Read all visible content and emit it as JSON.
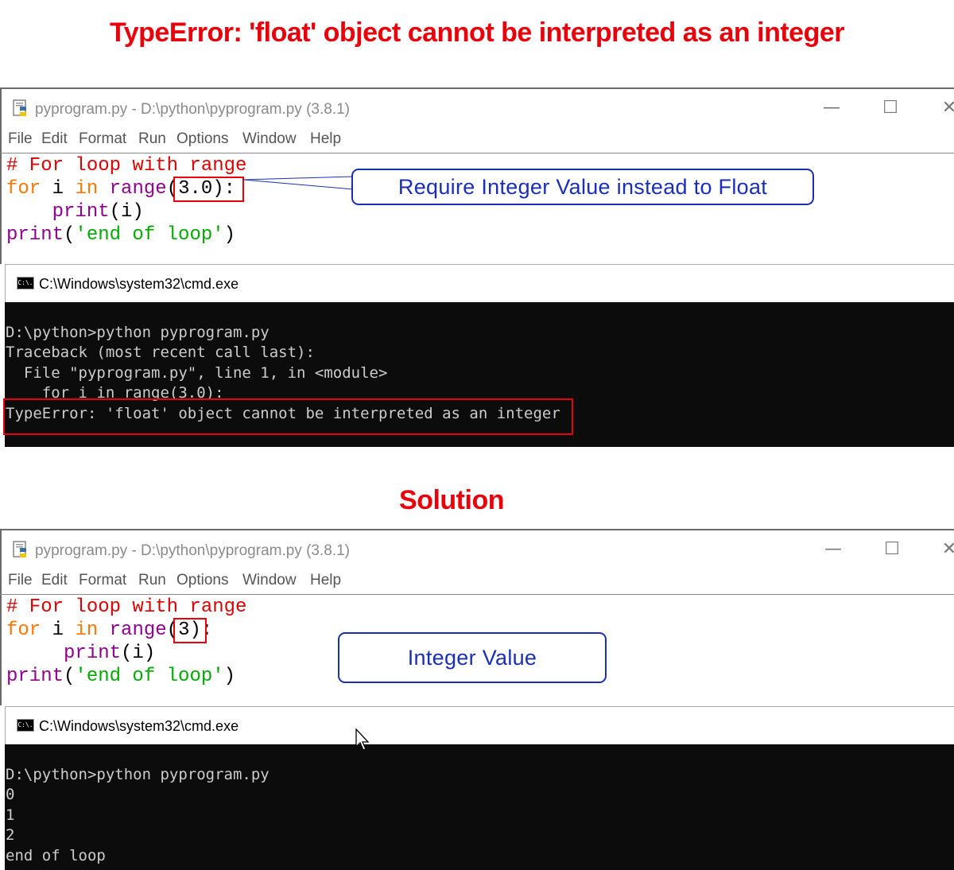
{
  "top_heading": "TypeError: 'float' object cannot be interpreted as an integer",
  "solution_heading": "Solution",
  "idle_window_1": {
    "title": "pyprogram.py - D:\\python\\pyprogram.py (3.8.1)",
    "menu": [
      "File",
      "Edit",
      "Format",
      "Run",
      "Options",
      "Window",
      "Help"
    ],
    "code": {
      "comment": "# For loop with range",
      "line2_kw_for": "for",
      "line2_var": " i ",
      "line2_kw_in": "in",
      "line2_builtin": " range",
      "line2_arg": "(3.0):",
      "line3_indent": "    ",
      "line3_builtin": "print",
      "line3_rest": "(i)",
      "line4_builtin": "print",
      "line4_open": "(",
      "line4_str": "'end of loop'",
      "line4_close": ")"
    },
    "callout": "Require Integer Value instead to Float"
  },
  "cmd_window_1": {
    "title": "C:\\Windows\\system32\\cmd.exe",
    "lines": [
      "D:\\python>python pyprogram.py",
      "Traceback (most recent call last):",
      "  File \"pyprogram.py\", line 1, in <module>",
      "    for i in range(3.0):",
      "TypeError: 'float' object cannot be interpreted as an integer"
    ]
  },
  "idle_window_2": {
    "title": "pyprogram.py - D:\\python\\pyprogram.py (3.8.1)",
    "menu": [
      "File",
      "Edit",
      "Format",
      "Run",
      "Options",
      "Window",
      "Help"
    ],
    "code": {
      "comment": "# For loop with range",
      "line2_kw_for": "for",
      "line2_var": " i ",
      "line2_kw_in": "in",
      "line2_builtin": " range",
      "line2_arg": "(3):",
      "line3_indent": "     ",
      "line3_builtin": "print",
      "line3_rest": "(i)",
      "line4_builtin": "print",
      "line4_open": "(",
      "line4_str": "'end of loop'",
      "line4_close": ")"
    },
    "callout": "Integer Value"
  },
  "cmd_window_2": {
    "title": "C:\\Windows\\system32\\cmd.exe",
    "lines": [
      "D:\\python>python pyprogram.py",
      "0",
      "1",
      "2",
      "end of loop"
    ]
  },
  "window_controls": {
    "minimize": "—",
    "maximize": "☐",
    "close": "✕"
  },
  "cmd_icon_text": "C:\\.",
  "colors": {
    "heading_red": "#e8000a",
    "callout_blue": "#1a2fb5",
    "idle_comment": "#dd0000",
    "idle_keyword": "#ff7700",
    "idle_builtin": "#900090",
    "idle_string": "#00aa00",
    "console_bg": "#0c0c0c",
    "console_text": "#cccccc"
  }
}
